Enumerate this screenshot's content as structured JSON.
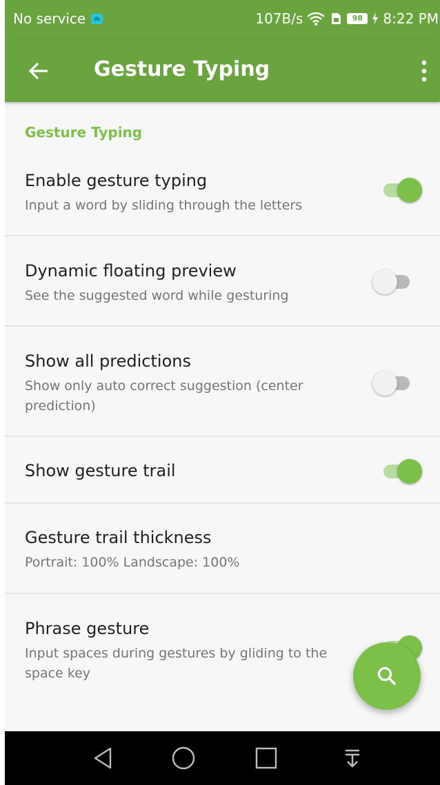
{
  "status_bar": {
    "carrier": "No service",
    "network_speed": "107B/s",
    "battery_level": "98",
    "time": "8:22 PM"
  },
  "toolbar": {
    "title": "Gesture Typing",
    "back_icon": "arrow-back-icon",
    "menu_icon": "more-vert-icon"
  },
  "section": {
    "header": "Gesture Typing"
  },
  "preferences": [
    {
      "title": "Enable gesture typing",
      "summary": "Input a word by sliding through the letters",
      "toggle": true
    },
    {
      "title": "Dynamic floating preview",
      "summary": "See the suggested word while gesturing",
      "toggle": false
    },
    {
      "title": "Show all predictions",
      "summary": "Show only auto correct suggestion (center prediction)",
      "toggle": false
    },
    {
      "title": "Show gesture trail",
      "summary": "",
      "toggle": true
    },
    {
      "title": "Gesture trail thickness",
      "summary": "Portrait: 100% Landscape: 100%"
    },
    {
      "title": "Phrase gesture",
      "summary": "Input spaces during gestures by gliding to the space key",
      "toggle": true
    }
  ],
  "fab": {
    "icon": "search-icon"
  },
  "nav_bar": {
    "icons": [
      "back-triangle-icon",
      "home-circle-icon",
      "recents-square-icon",
      "notification-pull-down-icon"
    ]
  },
  "colors": {
    "primary": "#6aa43e",
    "accent": "#7cc04a",
    "background": "#f7f7f7"
  }
}
